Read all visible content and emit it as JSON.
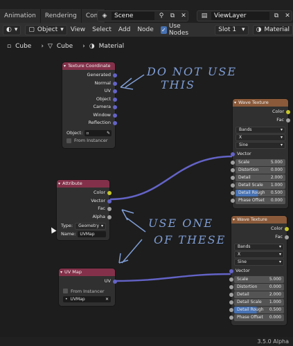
{
  "top_tabs": [
    "Animation",
    "Rendering",
    "Compo"
  ],
  "scene": {
    "label": "Scene"
  },
  "view_layer": {
    "label": "ViewLayer"
  },
  "header": {
    "object_mode": "Object",
    "menus": [
      "View",
      "Select",
      "Add",
      "Node"
    ],
    "use_nodes": "Use Nodes",
    "slot": "Slot 1",
    "material": "Material"
  },
  "breadcrumb": [
    "Cube",
    "Cube",
    "Material"
  ],
  "nodes": {
    "texcoord": {
      "title": "Texture Coordinate",
      "outputs": [
        "Generated",
        "Normal",
        "UV",
        "Object",
        "Camera",
        "Window",
        "Reflection"
      ],
      "object_label": "Object:",
      "from_instancer": "From Instancer"
    },
    "attribute": {
      "title": "Attribute",
      "outputs": [
        "Color",
        "Vector",
        "Fac",
        "Alpha"
      ],
      "type_label": "Type:",
      "type_value": "Geometry",
      "name_label": "Name:",
      "name_value": "UVMap"
    },
    "uvmap": {
      "title": "UV Map",
      "output": "UV",
      "from_instancer": "From Instancer",
      "map": "UVMap"
    },
    "wave1": {
      "title": "Wave Texture",
      "outputs": [
        "Color",
        "Fac"
      ],
      "dropdowns": [
        "Bands",
        "X",
        "Sine"
      ],
      "vector": "Vector",
      "fields": [
        {
          "label": "Scale",
          "value": "5.000"
        },
        {
          "label": "Distortion",
          "value": "0.000"
        },
        {
          "label": "Detail",
          "value": "2.000"
        },
        {
          "label": "Detail Scale",
          "value": "1.000"
        },
        {
          "label": "Detail Rough",
          "value": "0.500"
        },
        {
          "label": "Phase Offset",
          "value": "0.000"
        }
      ]
    },
    "wave2": {
      "title": "Wave Texture",
      "outputs": [
        "Color",
        "Fac"
      ],
      "dropdowns": [
        "Bands",
        "X",
        "Sine"
      ],
      "vector": "Vector",
      "fields": [
        {
          "label": "Scale",
          "value": "5.000"
        },
        {
          "label": "Distortion",
          "value": "0.000"
        },
        {
          "label": "Detail",
          "value": "2.000"
        },
        {
          "label": "Detail Scale",
          "value": "1.000"
        },
        {
          "label": "Detail Rough",
          "value": "0.500"
        },
        {
          "label": "Phase Offset",
          "value": "0.000"
        }
      ]
    }
  },
  "annotations": {
    "do_not_use": [
      "DO NOT USE",
      "THIS"
    ],
    "use_one": [
      "USE ONE",
      "OF THESE"
    ]
  },
  "version": "3.5.0 Alpha",
  "colors": {
    "accent": "#4772b3",
    "link": "#6363c7",
    "header_red": "#83314a",
    "header_orange": "#8a5a3a",
    "ink": "#7f9ed6"
  }
}
